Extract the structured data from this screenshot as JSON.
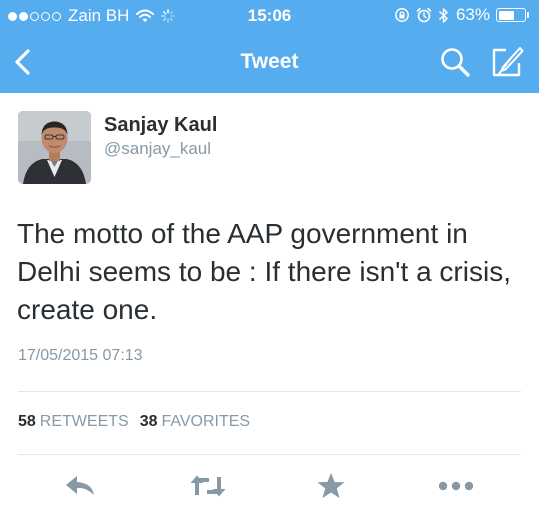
{
  "status_bar": {
    "carrier": "Zain BH",
    "time": "15:06",
    "battery_percent": "63%",
    "battery_level": 0.63,
    "signal_bars": 2
  },
  "nav": {
    "title": "Tweet",
    "back_icon": "chevron-left-icon",
    "search_icon": "search-icon",
    "compose_icon": "compose-icon"
  },
  "tweet": {
    "author_name": "Sanjay Kaul",
    "author_handle": "@sanjay_kaul",
    "text": "The motto of the AAP government in Delhi seems to be : If there isn't a crisis, create one.",
    "timestamp": "17/05/2015 07:13",
    "stats": {
      "retweets_count": "58",
      "retweets_label": "RETWEETS",
      "favorites_count": "38",
      "favorites_label": "FAVORITES"
    }
  },
  "actions": [
    "reply-icon",
    "retweet-icon",
    "star-icon",
    "more-icon"
  ],
  "colors": {
    "brand_blue": "#55acee",
    "text_primary": "#292f33",
    "text_secondary": "#8899a6",
    "action_gray": "#8899a6",
    "divider": "#e1e8ed"
  }
}
